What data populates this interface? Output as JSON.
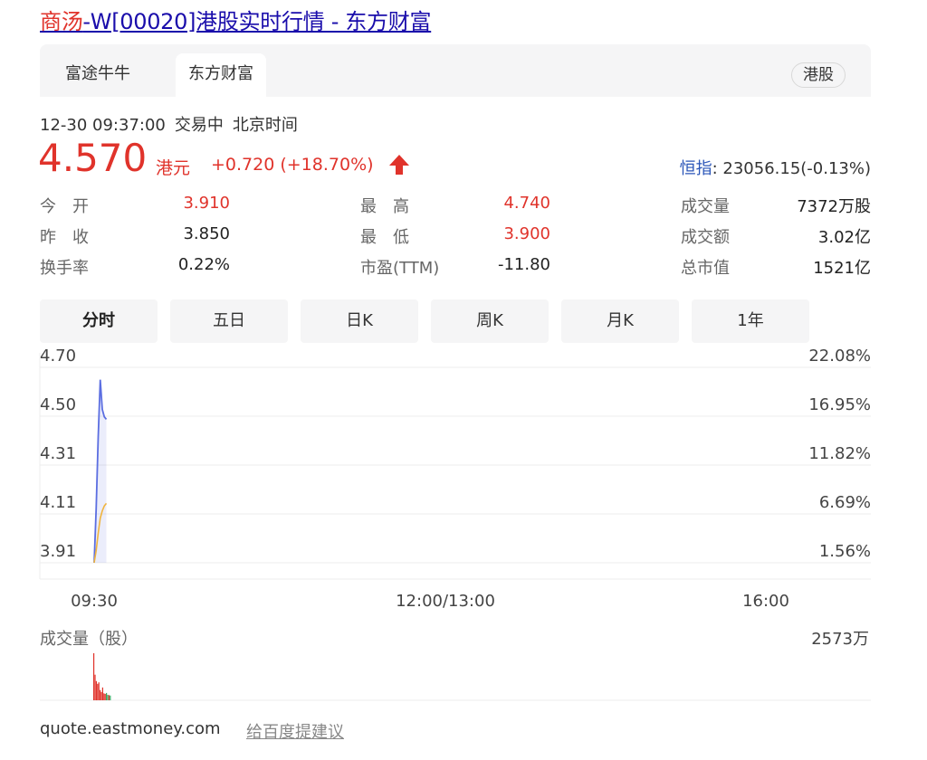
{
  "title": {
    "highlight": "商汤",
    "rest": "-W[00020]港股实时行情 - 东方财富"
  },
  "source_tabs": [
    {
      "label": "富途牛牛",
      "active": false
    },
    {
      "label": "东方财富",
      "active": true
    }
  ],
  "market_badge": "港股",
  "status": {
    "datetime": "12-30 09:37:00",
    "state": "交易中",
    "timezone": "北京时间"
  },
  "quote": {
    "price": "4.570",
    "unit": "港元",
    "change": "+0.720 (+18.70%)",
    "direction": "up",
    "index_label": "恒指",
    "index_value": ": 23056.15(-0.13%)"
  },
  "stats": [
    [
      {
        "label": "今　开",
        "value": "3.910",
        "red": true
      },
      {
        "label": "最　高",
        "value": "4.740",
        "red": true
      },
      {
        "label": "成交量",
        "value": "7372万股",
        "red": false
      }
    ],
    [
      {
        "label": "昨　收",
        "value": "3.850",
        "red": false
      },
      {
        "label": "最　低",
        "value": "3.900",
        "red": true
      },
      {
        "label": "成交额",
        "value": "3.02亿",
        "red": false
      }
    ],
    [
      {
        "label": "换手率",
        "value": "0.22%",
        "red": false
      },
      {
        "label": "市盈(TTM)",
        "value": "-11.80",
        "red": false
      },
      {
        "label": "总市值",
        "value": "1521亿",
        "red": false
      }
    ]
  ],
  "period_tabs": [
    {
      "label": "分时",
      "active": true
    },
    {
      "label": "五日",
      "active": false
    },
    {
      "label": "日K",
      "active": false
    },
    {
      "label": "周K",
      "active": false
    },
    {
      "label": "月K",
      "active": false
    },
    {
      "label": "1年",
      "active": false
    }
  ],
  "chart_data": {
    "type": "line",
    "price_axis": {
      "labels": [
        "4.70",
        "4.50",
        "4.31",
        "4.11",
        "3.91"
      ],
      "range": [
        3.91,
        4.7
      ]
    },
    "percent_axis": {
      "labels": [
        "22.08%",
        "16.95%",
        "11.82%",
        "6.69%",
        "1.56%"
      ]
    },
    "time_axis": {
      "labels": [
        "09:30",
        "12:00/13:00",
        "16:00"
      ],
      "total_minutes": 330
    },
    "price_series": {
      "name": "price",
      "color": "#5b6ee1",
      "points": [
        [
          0,
          3.91
        ],
        [
          1,
          4.13
        ],
        [
          2,
          4.42
        ],
        [
          3,
          4.65
        ],
        [
          4,
          4.53
        ],
        [
          5,
          4.5
        ],
        [
          6,
          4.49
        ]
      ]
    },
    "avg_series": {
      "name": "average",
      "color": "#f0b43c",
      "points": [
        [
          0,
          3.91
        ],
        [
          1,
          3.96
        ],
        [
          2,
          4.03
        ],
        [
          3,
          4.09
        ],
        [
          4,
          4.12
        ],
        [
          5,
          4.14
        ],
        [
          6,
          4.15
        ]
      ]
    },
    "volume_label": "成交量（股）",
    "volume_max_label": "2573万",
    "volume_max": 2573,
    "volume_bars": [
      {
        "value": 2573,
        "color": "#e0332b"
      },
      {
        "value": 1400,
        "color": "#e0332b"
      },
      {
        "value": 1050,
        "color": "#e0332b"
      },
      {
        "value": 900,
        "color": "#e0332b"
      },
      {
        "value": 980,
        "color": "#e0332b"
      },
      {
        "value": 560,
        "color": "#e0332b"
      },
      {
        "value": 450,
        "color": "#e0332b"
      },
      {
        "value": 700,
        "color": "#e0332b"
      },
      {
        "value": 380,
        "color": "#e0332b"
      },
      {
        "value": 350,
        "color": "#e0332b"
      },
      {
        "value": 400,
        "color": "#3aa55c"
      },
      {
        "value": 300,
        "color": "#3aa55c"
      },
      {
        "value": 280,
        "color": "#e0332b"
      },
      {
        "value": 260,
        "color": "#3aa55c"
      }
    ]
  },
  "footer": {
    "source": "quote.eastmoney.com",
    "feedback": "给百度提建议"
  }
}
